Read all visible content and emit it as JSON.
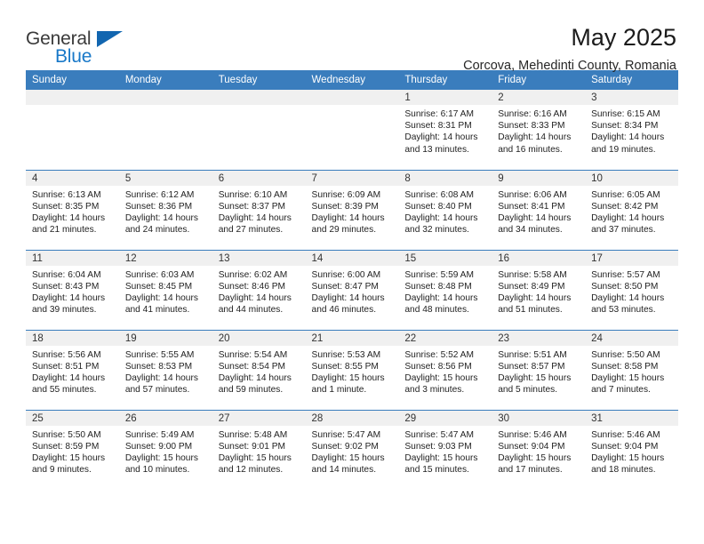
{
  "brand": {
    "name_top": "General",
    "name_bottom": "Blue",
    "accent_color": "#1266b0"
  },
  "header": {
    "title": "May 2025",
    "location": "Corcova, Mehedinti County, Romania"
  },
  "calendar": {
    "header_color": "#3a7dbd",
    "daynum_band_color": "#f0f0f0",
    "weekday_headers": [
      "Sunday",
      "Monday",
      "Tuesday",
      "Wednesday",
      "Thursday",
      "Friday",
      "Saturday"
    ],
    "weeks": [
      [
        {
          "day": "",
          "empty": true
        },
        {
          "day": "",
          "empty": true
        },
        {
          "day": "",
          "empty": true
        },
        {
          "day": "",
          "empty": true
        },
        {
          "day": "1",
          "sunrise": "Sunrise: 6:17 AM",
          "sunset": "Sunset: 8:31 PM",
          "daylight_line1": "Daylight: 14 hours",
          "daylight_line2": "and 13 minutes."
        },
        {
          "day": "2",
          "sunrise": "Sunrise: 6:16 AM",
          "sunset": "Sunset: 8:33 PM",
          "daylight_line1": "Daylight: 14 hours",
          "daylight_line2": "and 16 minutes."
        },
        {
          "day": "3",
          "sunrise": "Sunrise: 6:15 AM",
          "sunset": "Sunset: 8:34 PM",
          "daylight_line1": "Daylight: 14 hours",
          "daylight_line2": "and 19 minutes."
        }
      ],
      [
        {
          "day": "4",
          "sunrise": "Sunrise: 6:13 AM",
          "sunset": "Sunset: 8:35 PM",
          "daylight_line1": "Daylight: 14 hours",
          "daylight_line2": "and 21 minutes."
        },
        {
          "day": "5",
          "sunrise": "Sunrise: 6:12 AM",
          "sunset": "Sunset: 8:36 PM",
          "daylight_line1": "Daylight: 14 hours",
          "daylight_line2": "and 24 minutes."
        },
        {
          "day": "6",
          "sunrise": "Sunrise: 6:10 AM",
          "sunset": "Sunset: 8:37 PM",
          "daylight_line1": "Daylight: 14 hours",
          "daylight_line2": "and 27 minutes."
        },
        {
          "day": "7",
          "sunrise": "Sunrise: 6:09 AM",
          "sunset": "Sunset: 8:39 PM",
          "daylight_line1": "Daylight: 14 hours",
          "daylight_line2": "and 29 minutes."
        },
        {
          "day": "8",
          "sunrise": "Sunrise: 6:08 AM",
          "sunset": "Sunset: 8:40 PM",
          "daylight_line1": "Daylight: 14 hours",
          "daylight_line2": "and 32 minutes."
        },
        {
          "day": "9",
          "sunrise": "Sunrise: 6:06 AM",
          "sunset": "Sunset: 8:41 PM",
          "daylight_line1": "Daylight: 14 hours",
          "daylight_line2": "and 34 minutes."
        },
        {
          "day": "10",
          "sunrise": "Sunrise: 6:05 AM",
          "sunset": "Sunset: 8:42 PM",
          "daylight_line1": "Daylight: 14 hours",
          "daylight_line2": "and 37 minutes."
        }
      ],
      [
        {
          "day": "11",
          "sunrise": "Sunrise: 6:04 AM",
          "sunset": "Sunset: 8:43 PM",
          "daylight_line1": "Daylight: 14 hours",
          "daylight_line2": "and 39 minutes."
        },
        {
          "day": "12",
          "sunrise": "Sunrise: 6:03 AM",
          "sunset": "Sunset: 8:45 PM",
          "daylight_line1": "Daylight: 14 hours",
          "daylight_line2": "and 41 minutes."
        },
        {
          "day": "13",
          "sunrise": "Sunrise: 6:02 AM",
          "sunset": "Sunset: 8:46 PM",
          "daylight_line1": "Daylight: 14 hours",
          "daylight_line2": "and 44 minutes."
        },
        {
          "day": "14",
          "sunrise": "Sunrise: 6:00 AM",
          "sunset": "Sunset: 8:47 PM",
          "daylight_line1": "Daylight: 14 hours",
          "daylight_line2": "and 46 minutes."
        },
        {
          "day": "15",
          "sunrise": "Sunrise: 5:59 AM",
          "sunset": "Sunset: 8:48 PM",
          "daylight_line1": "Daylight: 14 hours",
          "daylight_line2": "and 48 minutes."
        },
        {
          "day": "16",
          "sunrise": "Sunrise: 5:58 AM",
          "sunset": "Sunset: 8:49 PM",
          "daylight_line1": "Daylight: 14 hours",
          "daylight_line2": "and 51 minutes."
        },
        {
          "day": "17",
          "sunrise": "Sunrise: 5:57 AM",
          "sunset": "Sunset: 8:50 PM",
          "daylight_line1": "Daylight: 14 hours",
          "daylight_line2": "and 53 minutes."
        }
      ],
      [
        {
          "day": "18",
          "sunrise": "Sunrise: 5:56 AM",
          "sunset": "Sunset: 8:51 PM",
          "daylight_line1": "Daylight: 14 hours",
          "daylight_line2": "and 55 minutes."
        },
        {
          "day": "19",
          "sunrise": "Sunrise: 5:55 AM",
          "sunset": "Sunset: 8:53 PM",
          "daylight_line1": "Daylight: 14 hours",
          "daylight_line2": "and 57 minutes."
        },
        {
          "day": "20",
          "sunrise": "Sunrise: 5:54 AM",
          "sunset": "Sunset: 8:54 PM",
          "daylight_line1": "Daylight: 14 hours",
          "daylight_line2": "and 59 minutes."
        },
        {
          "day": "21",
          "sunrise": "Sunrise: 5:53 AM",
          "sunset": "Sunset: 8:55 PM",
          "daylight_line1": "Daylight: 15 hours",
          "daylight_line2": "and 1 minute."
        },
        {
          "day": "22",
          "sunrise": "Sunrise: 5:52 AM",
          "sunset": "Sunset: 8:56 PM",
          "daylight_line1": "Daylight: 15 hours",
          "daylight_line2": "and 3 minutes."
        },
        {
          "day": "23",
          "sunrise": "Sunrise: 5:51 AM",
          "sunset": "Sunset: 8:57 PM",
          "daylight_line1": "Daylight: 15 hours",
          "daylight_line2": "and 5 minutes."
        },
        {
          "day": "24",
          "sunrise": "Sunrise: 5:50 AM",
          "sunset": "Sunset: 8:58 PM",
          "daylight_line1": "Daylight: 15 hours",
          "daylight_line2": "and 7 minutes."
        }
      ],
      [
        {
          "day": "25",
          "sunrise": "Sunrise: 5:50 AM",
          "sunset": "Sunset: 8:59 PM",
          "daylight_line1": "Daylight: 15 hours",
          "daylight_line2": "and 9 minutes."
        },
        {
          "day": "26",
          "sunrise": "Sunrise: 5:49 AM",
          "sunset": "Sunset: 9:00 PM",
          "daylight_line1": "Daylight: 15 hours",
          "daylight_line2": "and 10 minutes."
        },
        {
          "day": "27",
          "sunrise": "Sunrise: 5:48 AM",
          "sunset": "Sunset: 9:01 PM",
          "daylight_line1": "Daylight: 15 hours",
          "daylight_line2": "and 12 minutes."
        },
        {
          "day": "28",
          "sunrise": "Sunrise: 5:47 AM",
          "sunset": "Sunset: 9:02 PM",
          "daylight_line1": "Daylight: 15 hours",
          "daylight_line2": "and 14 minutes."
        },
        {
          "day": "29",
          "sunrise": "Sunrise: 5:47 AM",
          "sunset": "Sunset: 9:03 PM",
          "daylight_line1": "Daylight: 15 hours",
          "daylight_line2": "and 15 minutes."
        },
        {
          "day": "30",
          "sunrise": "Sunrise: 5:46 AM",
          "sunset": "Sunset: 9:04 PM",
          "daylight_line1": "Daylight: 15 hours",
          "daylight_line2": "and 17 minutes."
        },
        {
          "day": "31",
          "sunrise": "Sunrise: 5:46 AM",
          "sunset": "Sunset: 9:04 PM",
          "daylight_line1": "Daylight: 15 hours",
          "daylight_line2": "and 18 minutes."
        }
      ]
    ]
  }
}
